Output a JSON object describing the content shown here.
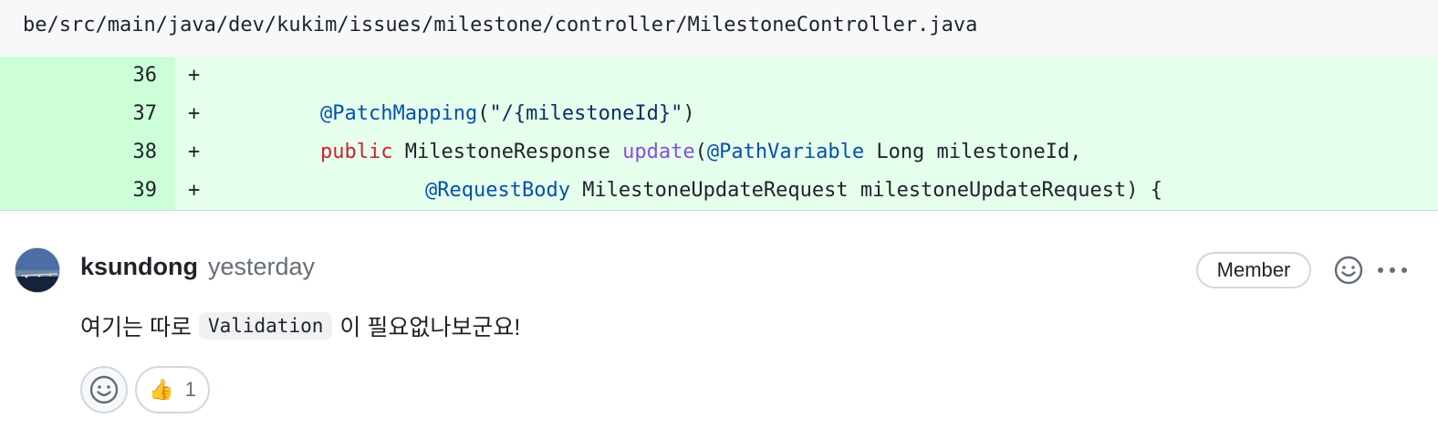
{
  "file": {
    "path": "be/src/main/java/dev/kukim/issues/milestone/controller/MilestoneController.java"
  },
  "diff": {
    "lines": [
      {
        "number": "36",
        "marker": "+"
      },
      {
        "number": "37",
        "marker": "+"
      },
      {
        "number": "38",
        "marker": "+"
      },
      {
        "number": "39",
        "marker": "+"
      }
    ],
    "tokens": {
      "l37_annot": "@PatchMapping",
      "l37_open": "(",
      "l37_str": "\"/{milestoneId}\"",
      "l37_close": ")",
      "l38_kw": "public",
      "l38_type": " MilestoneResponse ",
      "l38_fn": "update",
      "l38_open": "(",
      "l38_annot": "@PathVariable",
      "l38_rest": " Long milestoneId,",
      "l39_annot": "@RequestBody",
      "l39_rest": " MilestoneUpdateRequest milestoneUpdateRequest) {"
    },
    "colors": {
      "added_bg": "#e6ffec",
      "added_num_bg": "#ccffd8",
      "annotation": "#0550ae",
      "keyword": "#cf222e",
      "function": "#8250df",
      "string": "#0a3069"
    }
  },
  "comment": {
    "author": "ksundong",
    "timestamp": "yesterday",
    "badge": "Member",
    "body_before": "여기는 따로",
    "body_code": "Validation",
    "body_after": "이 필요없나보군요!",
    "icons": {
      "add_reaction": "smiley-icon",
      "more": "kebab-horizontal-icon"
    },
    "reactions": [
      {
        "emoji": "👍",
        "count": "1"
      }
    ]
  }
}
